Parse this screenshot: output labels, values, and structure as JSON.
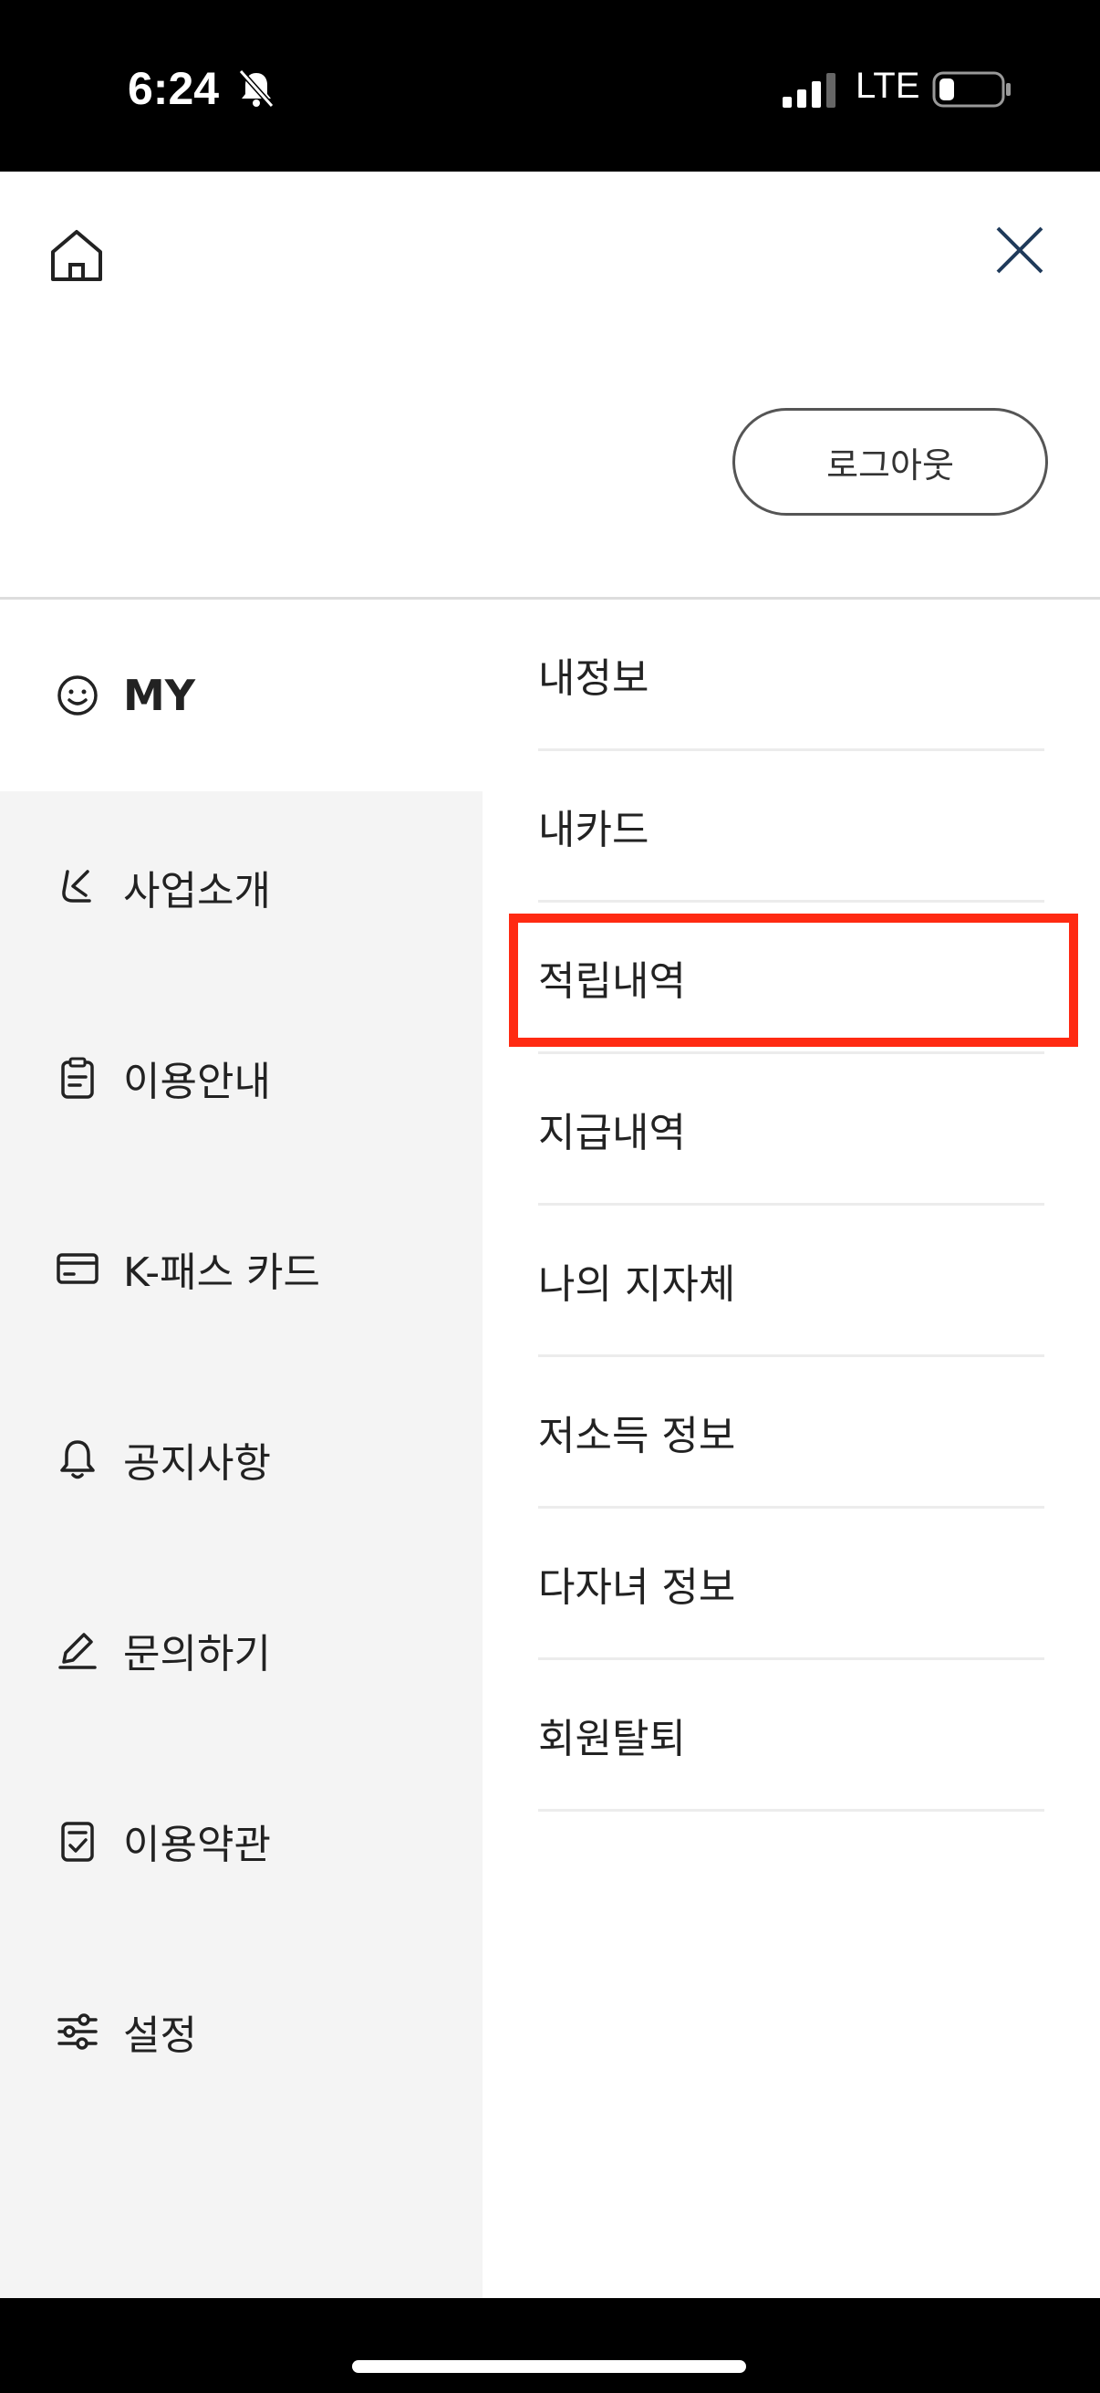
{
  "status_bar": {
    "time": "6:24",
    "network": "LTE",
    "icons": [
      "bell-muted-icon",
      "signal-icon",
      "battery-icon"
    ]
  },
  "header": {
    "home_icon": "home-icon",
    "close_icon": "close-icon",
    "logout_label": "로그아웃"
  },
  "left_menu": {
    "items": [
      {
        "label": "MY",
        "icon": "smile-icon",
        "selected": true
      },
      {
        "label": "사업소개",
        "icon": "k-logo-icon"
      },
      {
        "label": "이용안내",
        "icon": "clipboard-icon"
      },
      {
        "label": "K-패스 카드",
        "icon": "card-icon"
      },
      {
        "label": "공지사항",
        "icon": "bell-icon"
      },
      {
        "label": "문의하기",
        "icon": "pencil-icon"
      },
      {
        "label": "이용약관",
        "icon": "document-check-icon"
      },
      {
        "label": "설정",
        "icon": "sliders-icon"
      }
    ]
  },
  "sub_menu": {
    "items": [
      {
        "label": "내정보"
      },
      {
        "label": "내카드"
      },
      {
        "label": "적립내역",
        "highlighted": true
      },
      {
        "label": "지급내역"
      },
      {
        "label": "나의 지자체"
      },
      {
        "label": "저소득 정보"
      },
      {
        "label": "다자녀 정보"
      },
      {
        "label": "회원탈퇴"
      }
    ]
  },
  "colors": {
    "highlight": "#ff2a12",
    "left_bg": "#f4f4f4",
    "icon_navy": "#1f3a5a"
  }
}
